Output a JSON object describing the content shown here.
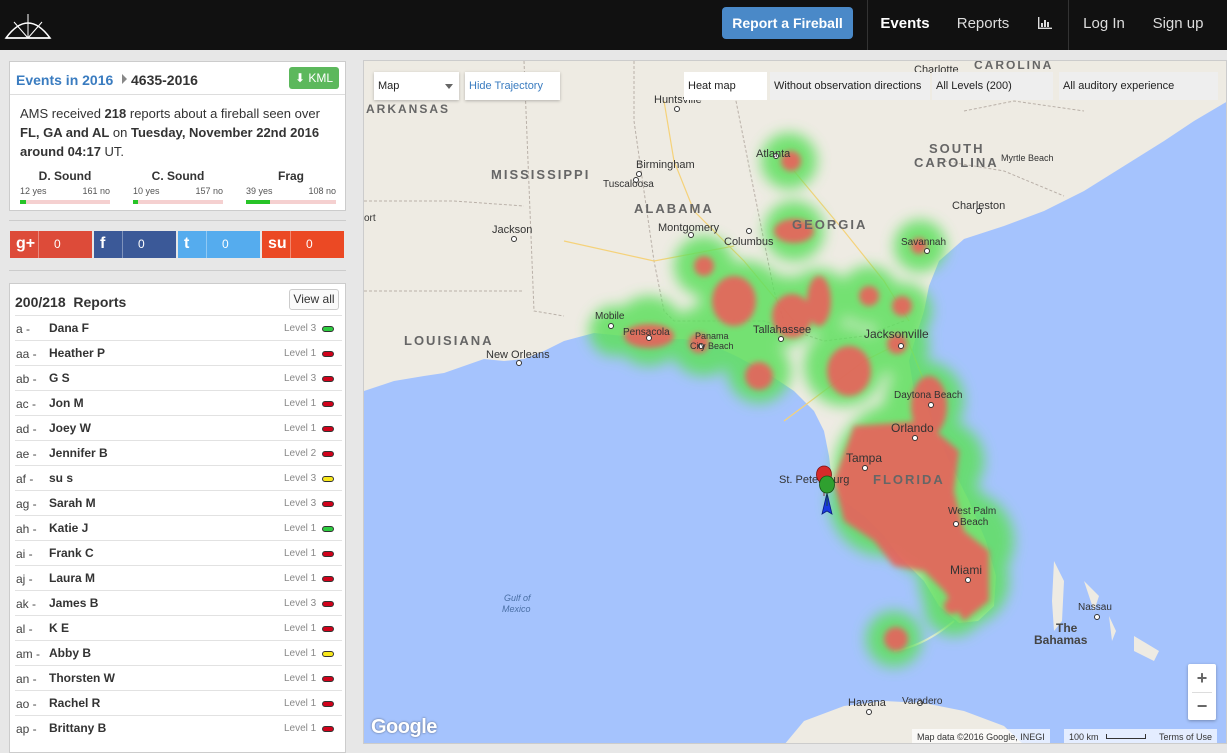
{
  "nav": {
    "report_button": "Report a Fireball",
    "events": "Events",
    "reports": "Reports",
    "chart_icon": "bar-chart-icon",
    "login": "Log In",
    "signup": "Sign up",
    "logo_icon": "ams-logo-icon"
  },
  "event": {
    "year_link": "Events in 2016",
    "event_id": "4635-2016",
    "kml_label": "KML",
    "kml_icon": "download-icon",
    "desc_prefix": "AMS received ",
    "report_count": "218",
    "desc_mid": " reports about a fireball seen over",
    "states": "FL, GA and AL",
    "desc_on": " on ",
    "date": "Tuesday, November 22nd 2016",
    "around": "around ",
    "time": "04:17",
    "tz": " UT.",
    "stats": [
      {
        "label": "D. Sound",
        "yes": "12 yes",
        "no": "161 no",
        "ratio": 0.069
      },
      {
        "label": "C. Sound",
        "yes": "10 yes",
        "no": "157 no",
        "ratio": 0.06
      },
      {
        "label": "Frag",
        "yes": "39 yes",
        "no": "108 no",
        "ratio": 0.265
      }
    ]
  },
  "share": [
    {
      "icon": "google-plus-icon",
      "glyph": "g+",
      "count": "0",
      "color": "#dd4b39"
    },
    {
      "icon": "facebook-icon",
      "glyph": "f",
      "count": "0",
      "color": "#3b5998"
    },
    {
      "icon": "twitter-icon",
      "glyph": "t",
      "count": "0",
      "color": "#55acee"
    },
    {
      "icon": "stumbleupon-icon",
      "glyph": "su",
      "count": "0",
      "color": "#eb4924"
    }
  ],
  "reports": {
    "count": "200/218",
    "label": "Reports",
    "view_all": "View all",
    "items": [
      {
        "letter": "a -",
        "name": "Dana F",
        "level": "Level 3",
        "color": "#2ecc40"
      },
      {
        "letter": "aa -",
        "name": "Heather P",
        "level": "Level 1",
        "color": "#d0021b"
      },
      {
        "letter": "ab -",
        "name": "G S",
        "level": "Level 3",
        "color": "#d0021b"
      },
      {
        "letter": "ac -",
        "name": "Jon M",
        "level": "Level 1",
        "color": "#d0021b"
      },
      {
        "letter": "ad -",
        "name": "Joey W",
        "level": "Level 1",
        "color": "#d0021b"
      },
      {
        "letter": "ae -",
        "name": "Jennifer B",
        "level": "Level 2",
        "color": "#d0021b"
      },
      {
        "letter": "af -",
        "name": "su s",
        "level": "Level 3",
        "color": "#f8e71c"
      },
      {
        "letter": "ag -",
        "name": "Sarah M",
        "level": "Level 3",
        "color": "#d0021b"
      },
      {
        "letter": "ah -",
        "name": "Katie J",
        "level": "Level 1",
        "color": "#2ecc40"
      },
      {
        "letter": "ai -",
        "name": "Frank C",
        "level": "Level 1",
        "color": "#d0021b"
      },
      {
        "letter": "aj -",
        "name": "Laura M",
        "level": "Level 1",
        "color": "#d0021b"
      },
      {
        "letter": "ak -",
        "name": "James B",
        "level": "Level 3",
        "color": "#d0021b"
      },
      {
        "letter": "al -",
        "name": "K E",
        "level": "Level 1",
        "color": "#d0021b"
      },
      {
        "letter": "am -",
        "name": "Abby B",
        "level": "Level 1",
        "color": "#f8e71c"
      },
      {
        "letter": "an -",
        "name": "Thorsten W",
        "level": "Level 1",
        "color": "#d0021b"
      },
      {
        "letter": "ao -",
        "name": "Rachel R",
        "level": "Level 1",
        "color": "#d0021b"
      },
      {
        "letter": "ap -",
        "name": "Brittany B",
        "level": "Level 1",
        "color": "#d0021b"
      }
    ]
  },
  "map": {
    "type_select": "Map",
    "hide_trajectory": "Hide Trajectory",
    "heat_map": "Heat map",
    "without_directions": "Without observation directions",
    "all_levels": "All Levels (200)",
    "auditory": "All auditory experience",
    "zoom_in": "+",
    "zoom_out": "−",
    "attribution": "Map data ©2016 Google, INEGI",
    "scale": "100 km",
    "terms": "Terms of Use",
    "google_logo": "Google",
    "labels": {
      "huntsville": "Huntsville",
      "charlotte": "Charlotte",
      "carolina": "CAROLINA",
      "arkansas": "ARKANSAS",
      "atlanta": "Atlanta",
      "south": "SOUTH",
      "carolina2": "CAROLINA",
      "myrtle": "Myrtle Beach",
      "birmingham": "Birmingham",
      "mississippi": "MISSISSIPPI",
      "tuscaloosa": "Tuscaloosa",
      "alabama": "ALABAMA",
      "georgia": "GEORGIA",
      "charleston": "Charleston",
      "jackson": "Jackson",
      "montgomery": "Montgomery",
      "columbus": "Columbus",
      "savannah": "Savannah",
      "port": "ort",
      "mobile": "Mobile",
      "pensacola": "Pensacola",
      "panama1": "Panama",
      "panama2": "City Beach",
      "tallahassee": "Tallahassee",
      "jacksonville": "Jacksonville",
      "louisiana": "LOUISIANA",
      "neworleans": "New Orleans",
      "daytona": "Daytona Beach",
      "orlando": "Orlando",
      "tampa": "Tampa",
      "stpete": "St. Petersburg",
      "florida": "FLORIDA",
      "westpalm1": "West Palm",
      "westpalm2": "Beach",
      "miami": "Miami",
      "gulf1": "Gulf of",
      "gulf2": "Mexico",
      "nassau": "Nassau",
      "bahamas1": "The",
      "bahamas2": "Bahamas",
      "havana": "Havana",
      "varadero": "Varadero"
    }
  }
}
